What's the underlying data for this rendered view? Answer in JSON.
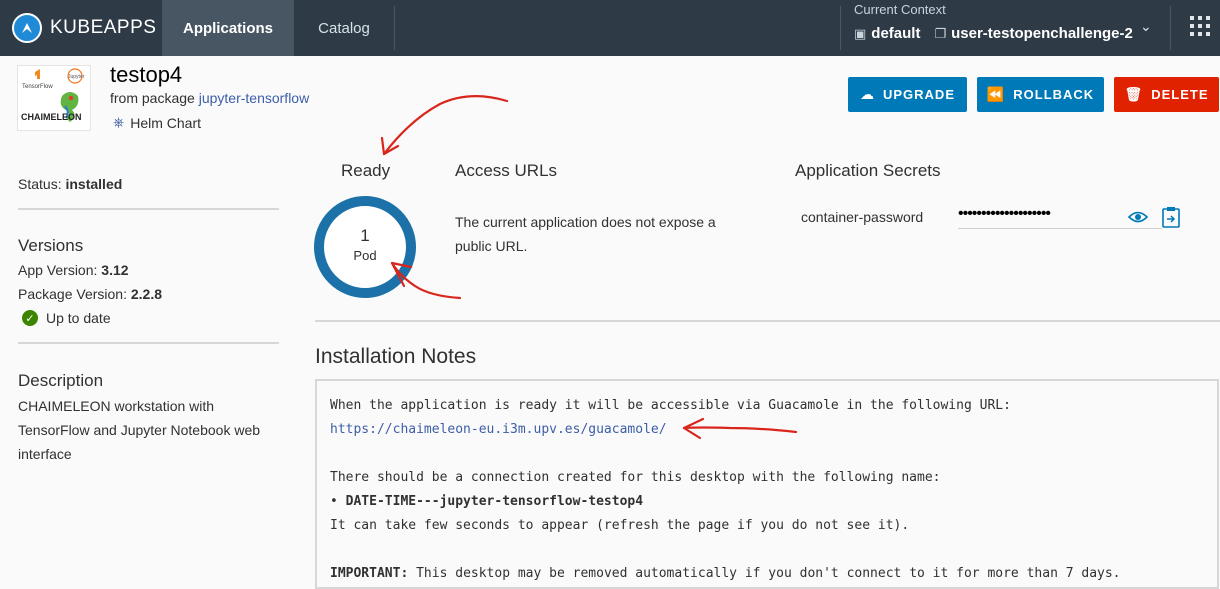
{
  "header": {
    "brand": "KUBEAPPS",
    "tabs": [
      {
        "label": "Applications",
        "active": true
      },
      {
        "label": "Catalog",
        "active": false
      }
    ],
    "context_label": "Current Context",
    "namespace": "default",
    "cluster": "user-testopenchallenge-2"
  },
  "app": {
    "title": "testop4",
    "from_prefix": "from package",
    "package": "jupyter-tensorflow",
    "chart_type": "Helm Chart",
    "logo_text": {
      "tf": "TensorFlow",
      "jupyter": "Jupyter",
      "chaimeleon": "CHAIMELEON"
    }
  },
  "actions": {
    "upgrade": "UPGRADE",
    "rollback": "ROLLBACK",
    "delete": "DELETE"
  },
  "sidebar": {
    "status_label": "Status:",
    "status_value": "installed",
    "versions_title": "Versions",
    "app_version_label": "App Version:",
    "app_version": "3.12",
    "package_version_label": "Package Version:",
    "package_version": "2.2.8",
    "up_to_date": "Up to date",
    "description_title": "Description",
    "description": "CHAIMELEON workstation with TensorFlow and Jupyter Notebook web interface"
  },
  "ready": {
    "title": "Ready",
    "count": "1",
    "unit": "Pod"
  },
  "access_urls": {
    "title": "Access URLs",
    "text": "The current application does not expose a public URL."
  },
  "secrets": {
    "title": "Application Secrets",
    "name": "container-password",
    "value": "••••••••••••••••••••"
  },
  "notes": {
    "title": "Installation Notes",
    "line1": "When the application is ready it will be accessible via Guacamole in the following URL:",
    "url": "https://chaimeleon-eu.i3m.upv.es/guacamole/",
    "line3": "There should be a connection created for this desktop with the following name:",
    "bullet": "•",
    "bullet_text": "DATE-TIME---jupyter-tensorflow-testop4",
    "line5": "It can take few seconds to appear (refresh the page if you do not see it).",
    "important_label": "IMPORTANT:",
    "important_text": " This desktop may be removed automatically if you don't connect to it for more than 7 days."
  },
  "colors": {
    "header_bg": "#2e3a46",
    "primary": "#0079b8",
    "danger": "#e12200",
    "ring": "#1b71a8",
    "annotation": "#d9261c"
  }
}
